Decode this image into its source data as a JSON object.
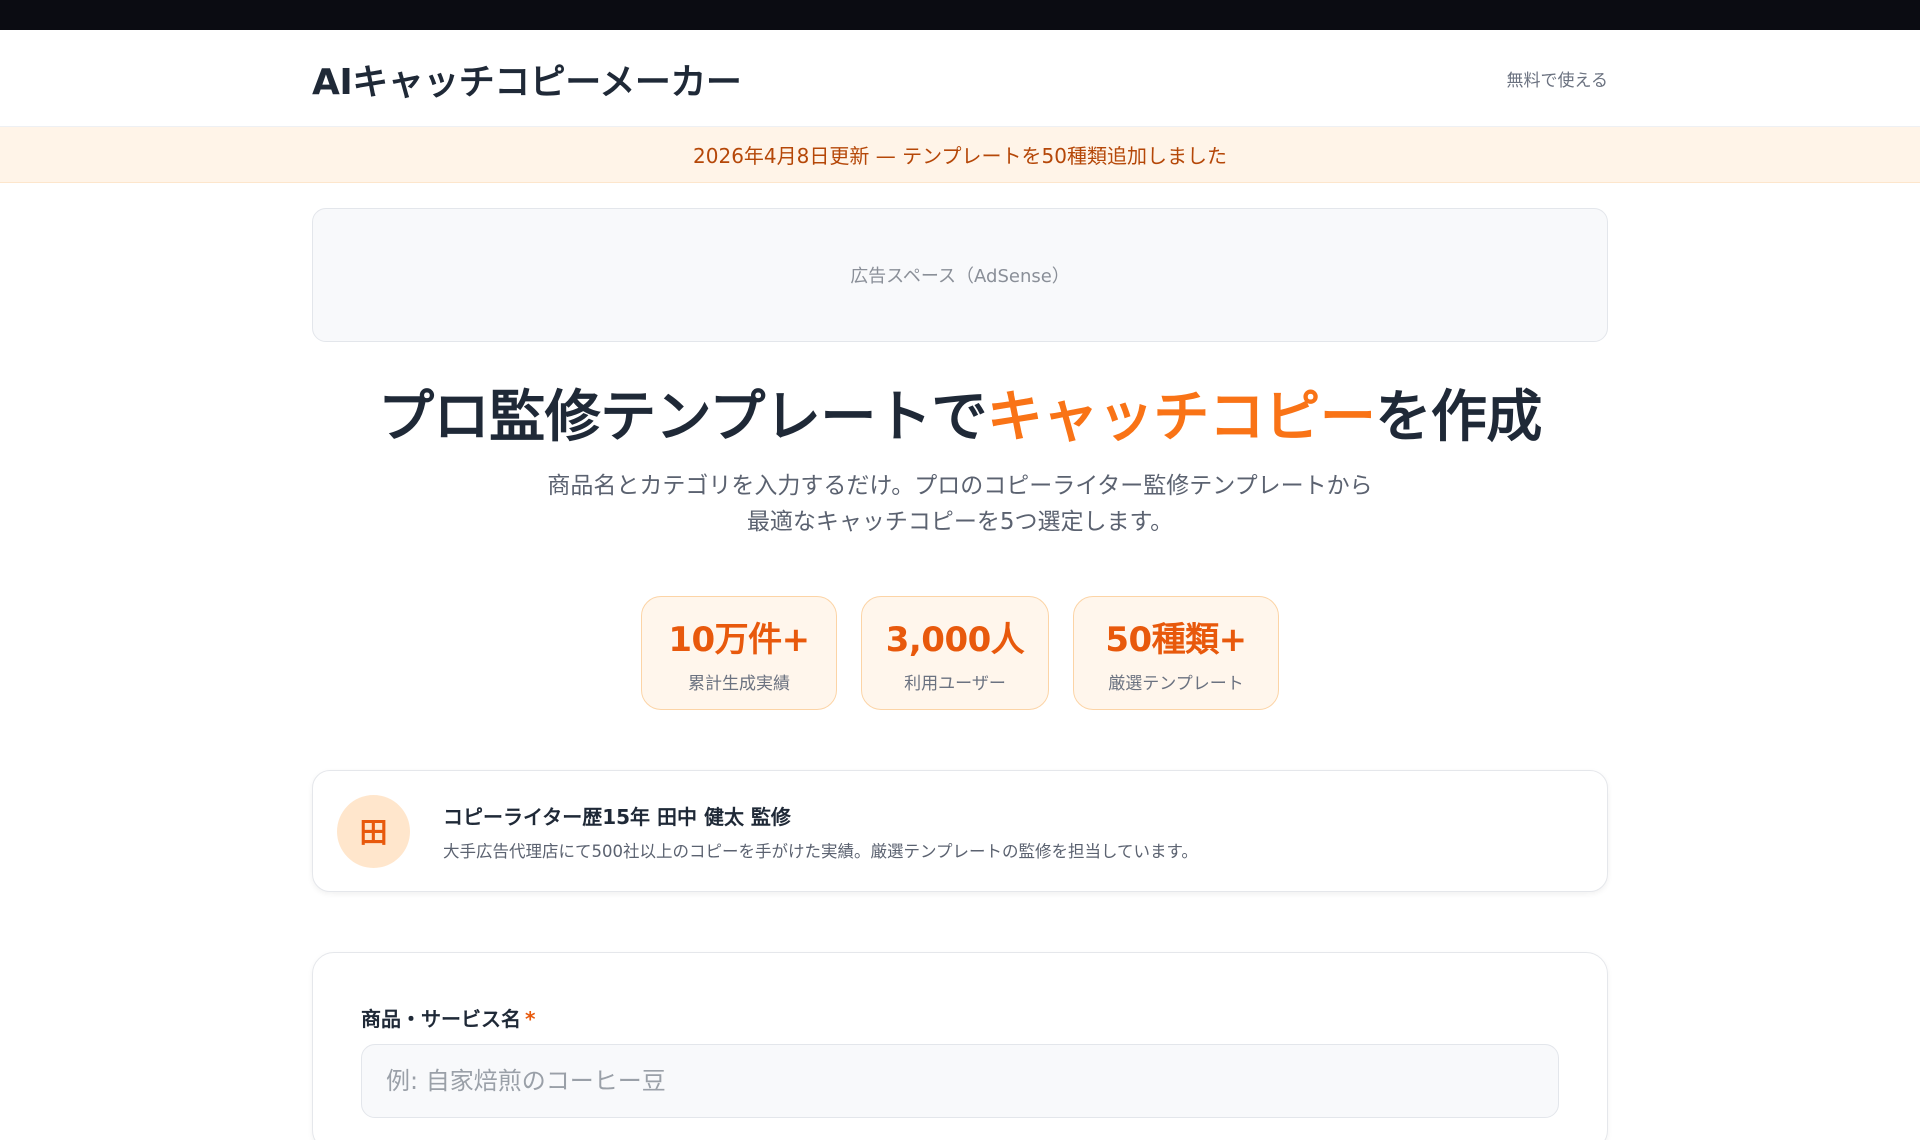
{
  "header": {
    "logo": "AIキャッチコピーメーカー",
    "link": "無料で使える"
  },
  "notice": {
    "text": "2026年4月8日更新 — テンプレートを50種類追加しました"
  },
  "ad": {
    "label": "広告スペース（AdSense）"
  },
  "hero": {
    "title_pre": "プロ監修テンプレートで",
    "title_accent": "キャッチコピー",
    "title_post": "を作成",
    "subtitle_line1": "商品名とカテゴリを入力するだけ。プロのコピーライター監修テンプレートから",
    "subtitle_line2": "最適なキャッチコピーを5つ選定します。"
  },
  "stats": [
    {
      "value": "10万件+",
      "label": "累計生成実績"
    },
    {
      "value": "3,000人",
      "label": "利用ユーザー"
    },
    {
      "value": "50種類+",
      "label": "厳選テンプレート"
    }
  ],
  "supervisor": {
    "avatar": "田",
    "name": "コピーライター歴15年 田中 健太 監修",
    "description": "大手広告代理店にて500社以上のコピーを手がけた実績。厳選テンプレートの監修を担当しています。"
  },
  "form": {
    "product_label": "商品・サービス名",
    "required_mark": "*",
    "product_value": "",
    "product_placeholder": "例: 自家焙煎のコーヒー豆"
  },
  "colors": {
    "accent": "#f97316",
    "accent_dark": "#e8590c",
    "notice_bg": "#fff4e8",
    "stat_bg": "#fff6ec",
    "topbar": "#0b0c12"
  }
}
